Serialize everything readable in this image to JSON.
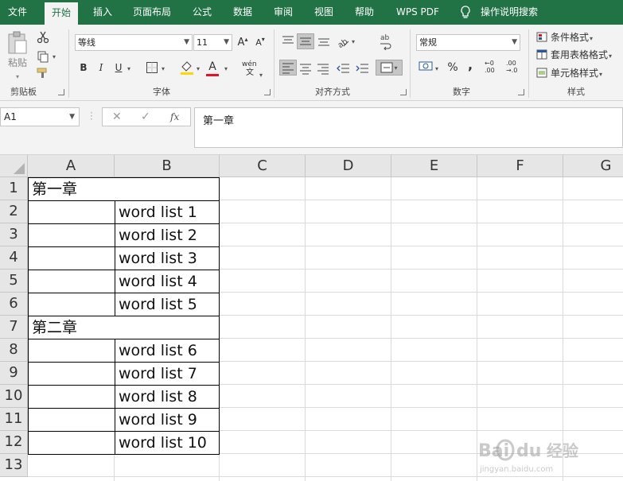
{
  "ribbon": {
    "tabs": [
      "文件",
      "开始",
      "插入",
      "页面布局",
      "公式",
      "数据",
      "审阅",
      "视图",
      "帮助",
      "WPS PDF"
    ],
    "active_tab": "开始",
    "tell_me": "操作说明搜索",
    "clipboard": {
      "paste": "粘贴",
      "label": "剪贴板"
    },
    "font": {
      "name": "等线",
      "size": "11",
      "label": "字体",
      "bold": "B",
      "italic": "I",
      "underline": "U",
      "wen": "wén"
    },
    "alignment": {
      "label": "对齐方式"
    },
    "number": {
      "format": "常规",
      "label": "数字",
      "percent": "%",
      "comma": ","
    },
    "styles": {
      "conditional": "条件格式",
      "table": "套用表格格式",
      "cell": "单元格样式",
      "label": "样式"
    }
  },
  "formula_bar": {
    "name_box": "A1",
    "content": "第一章",
    "fx": "fx"
  },
  "sheet": {
    "columns": [
      "A",
      "B",
      "C",
      "D",
      "E",
      "F",
      "G"
    ],
    "rows": [
      "1",
      "2",
      "3",
      "4",
      "5",
      "6",
      "7",
      "8",
      "9",
      "10",
      "11",
      "12",
      "13"
    ],
    "cells": {
      "A1": "第一章",
      "B2": "word list 1",
      "B3": "word list 2",
      "B4": "word list 3",
      "B5": "word list 4",
      "B6": "word list 5",
      "A7": "第二章",
      "B8": "word list 6",
      "B9": "word list 7",
      "B10": "word list 8",
      "B11": "word list 9",
      "B12": "word list 10"
    }
  },
  "colors": {
    "accent": "#217346",
    "ribbon_bg": "#f3f3f3",
    "header_bg": "#e6e6e6",
    "gridline": "#dadada",
    "font_color_bar": "#e81123",
    "fill_color_bar": "#ffd700"
  }
}
